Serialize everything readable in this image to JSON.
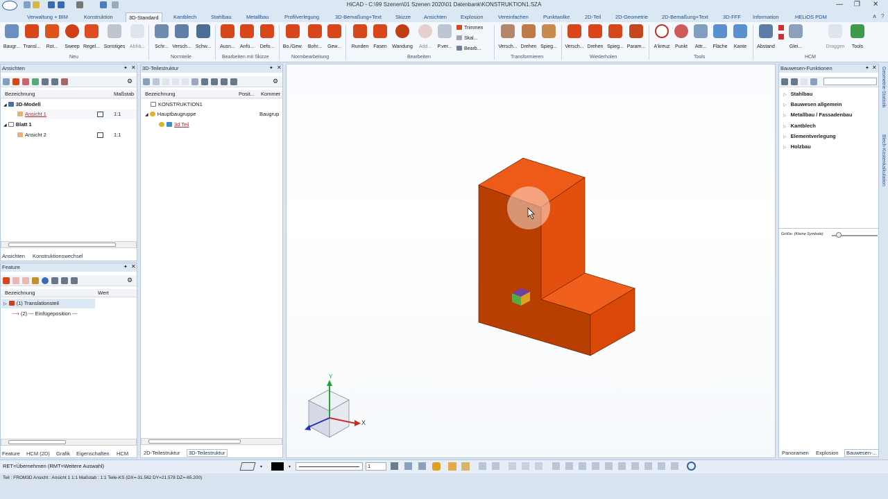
{
  "title": "HiCAD - C:\\99 Szenen\\01 Szenen 2020\\01 Datenbank\\KONSTRUKTION1.SZA",
  "menu_tabs": [
    "Verwaltung + BIM",
    "Konstruktion",
    "3D-Standard",
    "Kantblech",
    "Stahlbau",
    "Metallbau",
    "Profilverlegung",
    "3D-Bemaßung+Text",
    "Skizze",
    "Ansichten",
    "Explosion",
    "Vereinfachen",
    "Punktwolke",
    "2D-Teil",
    "2D-Geometrie",
    "2D-Bemaßung+Text",
    "3D-FFF",
    "Information",
    "HELiOS PDM"
  ],
  "active_tab": "3D-Standard",
  "ribbon": {
    "buttons": [
      "Baugr...",
      "Transl...",
      "Rot...",
      "Sweep",
      "Regel...",
      "Sonstiges",
      "Abhä...",
      "Schr...",
      "Versch...",
      "Schw...",
      "Ausn...",
      "Anfü...",
      "Defo...",
      "Bo./Gew.",
      "Bohr...",
      "Gew...",
      "Runden",
      "Fasen",
      "Wandung",
      "Add...",
      "P.ver...",
      "Versch...",
      "Drehen",
      "Spieg...",
      "Versch...",
      "Drehen",
      "Spieg...",
      "Param...",
      "A'kreuz",
      "Punkt",
      "Attr...",
      "Fläche",
      "Kante",
      "Abstand",
      "Glei...",
      "Draggen",
      "Tools"
    ],
    "small_buttons": [
      "Trimmen",
      "Skal...",
      "Bearb..."
    ],
    "groups": [
      "Neu",
      "Normteile",
      "Bearbeiten mit Skizze",
      "Normbearbeitung",
      "Bearbeiten",
      "Transformieren",
      "Wiederholen",
      "Tools",
      "HCM"
    ]
  },
  "ansichten": {
    "title": "Ansichten",
    "col_name": "Bezeichnung",
    "col_scale": "Maßstab",
    "rows": [
      {
        "label": "3D-Modell",
        "scale": ""
      },
      {
        "label": "Ansicht 1",
        "scale": "1:1"
      },
      {
        "label": "Blatt 1",
        "scale": ""
      },
      {
        "label": "Ansicht 2",
        "scale": "1:1"
      }
    ],
    "tabs": [
      "Ansichten",
      "Konstruktionswechsel"
    ]
  },
  "feature": {
    "title": "Feature",
    "col_name": "Bezeichnung",
    "col_value": "Wert",
    "rows": [
      "(1) Translationsteil",
      "(2) --- Einfügeposition ---"
    ],
    "tabs": [
      "Feature",
      "HCM (2D)",
      "Grafik",
      "Eigenschaften",
      "HCM"
    ]
  },
  "teilestruktur": {
    "title": "3D-Teilestruktur",
    "col_name": "Bezeichnung",
    "col_pos": "Posit...",
    "col_comment": "Kommer",
    "rows": [
      {
        "label": "KONSTRUKTION1",
        "comment": ""
      },
      {
        "label": "Hauptbaugruppe",
        "comment": "Baugrup"
      },
      {
        "label": "3d Teil",
        "comment": ""
      }
    ],
    "tabs": [
      "2D-Teilestruktur",
      "3D-Teilestruktur"
    ]
  },
  "bauwesen": {
    "title": "Bauwesen-Funktionen",
    "items": [
      "Stahlbau",
      "Bauwesen allgemein",
      "Metallbau / Fassadenbau",
      "Kantblech",
      "Elementverlegung",
      "Holzbau"
    ],
    "size_label": "Größe:",
    "size_value": "(Kleine Symbole)",
    "tabs": [
      "Panoramen",
      "Explosion",
      "Bauwesen-..."
    ]
  },
  "side_tabs": [
    "Geometrie-Statistik",
    "Blech-Kostenkalkulation"
  ],
  "axes": {
    "x": "X",
    "y": "Y"
  },
  "command_line": "RET=Übernehmen (RMT=Weitere Auswahl)",
  "line_width": "1",
  "status_line": "Teil : FROM3D   Ansicht : Ansicht 1 1:1   Maßstab : 1:1   Teile-KS   (DX=-31.562  DY=21.578  DZ=-65.200)",
  "colors": {
    "part_front": "#b73c00",
    "part_top": "#f05a16",
    "part_right": "#d94808",
    "accent": "#1c4e8a"
  }
}
